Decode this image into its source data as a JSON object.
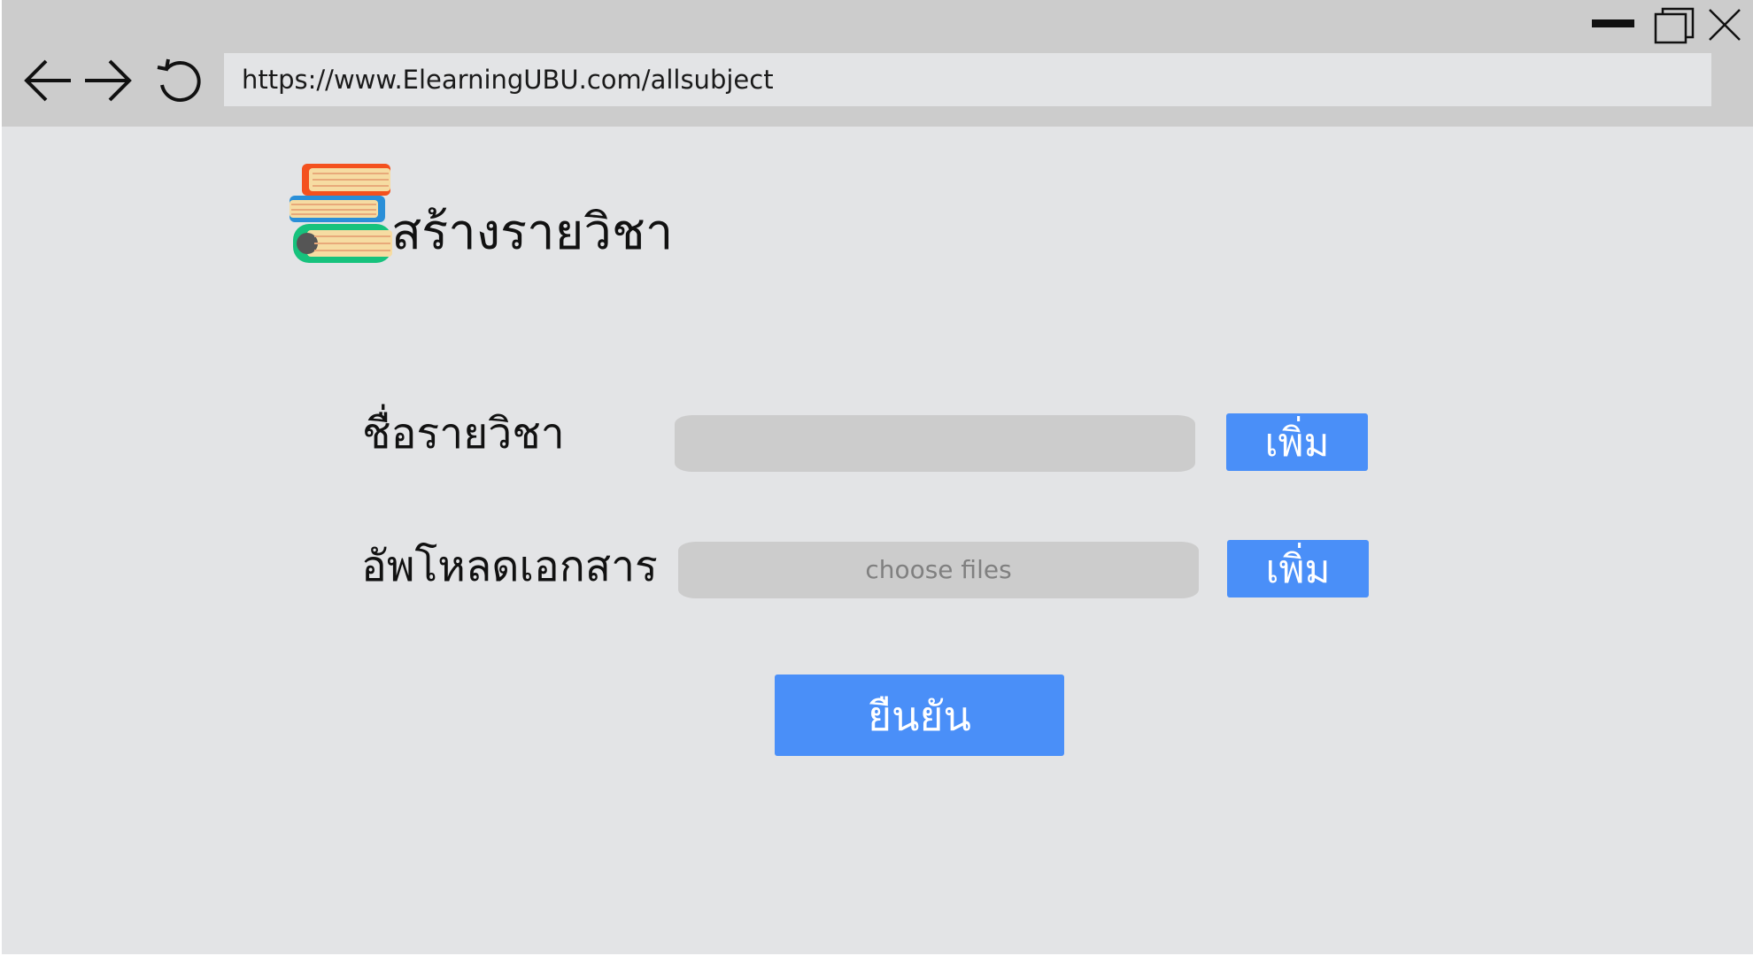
{
  "browser": {
    "url": "https://www.ElearningUBU.com/allsubject",
    "controls": {
      "minimize_icon": "minimize-icon",
      "maximize_icon": "maximize-icon",
      "close_icon": "close-icon",
      "back_icon": "back-arrow-icon",
      "forward_icon": "forward-arrow-icon",
      "reload_icon": "reload-icon"
    }
  },
  "page": {
    "title": "สร้างรายวิชา",
    "logo_icon": "books-stack-icon"
  },
  "form": {
    "subject_label": "ชื่อรายวิชา",
    "subject_value": "",
    "subject_add_label": "เพิ่ม",
    "upload_label": "อัพโหลดเอกสาร",
    "upload_placeholder": "choose files",
    "upload_add_label": "เพิ่ม",
    "confirm_label": "ยืนยัน"
  },
  "colors": {
    "accent": "#4a8ff8",
    "chrome": "#cccccc",
    "background": "#e3e4e6"
  }
}
